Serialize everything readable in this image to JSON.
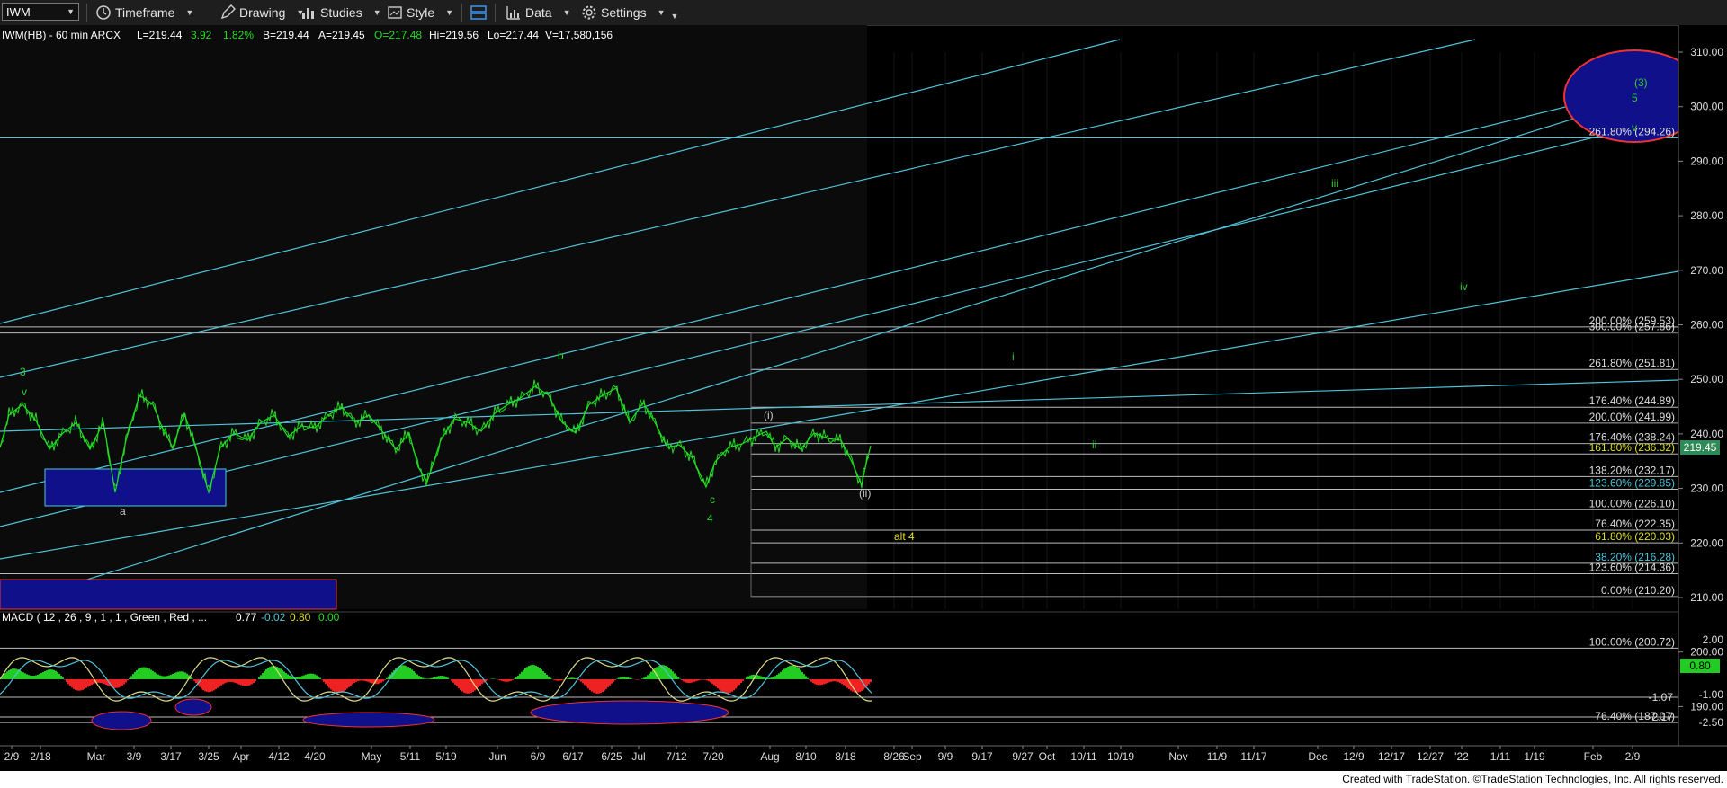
{
  "toolbar": {
    "symbol": "IWM",
    "timeframe": "Timeframe",
    "drawing": "Drawing",
    "studies": "Studies",
    "style": "Style",
    "data": "Data",
    "settings": "Settings"
  },
  "info": {
    "symbol": "IWM(HB) - 60 min  ARCX",
    "last_label": "L=219.44",
    "change": "3.92",
    "pct": "1.82%",
    "bid": "B=219.44",
    "ask": "A=219.45",
    "open": "O=217.48",
    "high": "Hi=219.56",
    "low": "Lo=217.44",
    "volume": "V=17,580,156"
  },
  "colors": {
    "price": "#22dd22",
    "trend": "#4fc3d8",
    "fib": "#cccccc",
    "wave_green": "#33cc33",
    "wave_yellow": "#dddd22",
    "rect_fill": "#10108a",
    "rect_border": "#ee3333",
    "macd_pos": "#22cc22",
    "macd_neg": "#ee2222",
    "last_tag": "#2e8b57"
  },
  "chart_data": [
    {
      "type": "line",
      "title": "IWM(HB) - 60 min ARCX",
      "y_axis_labels": [
        "310.00",
        "300.00",
        "290.00",
        "280.00",
        "270.00",
        "260.00",
        "250.00",
        "240.00",
        "230.00",
        "220.00",
        "210.00",
        "200.00",
        "190.00"
      ],
      "ylim": [
        183,
        314
      ],
      "x_axis_labels": [
        "2/9",
        "2/18",
        "Mar",
        "3/9",
        "3/17",
        "3/25",
        "Apr",
        "4/12",
        "4/20",
        "May",
        "5/11",
        "5/19",
        "Jun",
        "6/9",
        "6/17",
        "6/25",
        "Jul",
        "7/12",
        "7/20",
        "Aug",
        "8/10",
        "8/18",
        "8/26",
        "Sep",
        "9/9",
        "9/17",
        "9/27",
        "Oct",
        "10/11",
        "10/19",
        "Nov",
        "11/9",
        "11/17",
        "Dec",
        "12/9",
        "12/17",
        "12/27",
        "'22",
        "1/11",
        "1/19",
        "Feb",
        "2/9"
      ],
      "last_price": "219.45",
      "fib_labels": [
        {
          "text": "200.00% (259.53)",
          "value": 259.6
        },
        {
          "text": "300.00% (257.86)",
          "value": 258.5
        },
        {
          "text": "261.80% (251.81)",
          "value": 251.81
        },
        {
          "text": "176.40% (244.89)",
          "value": 244.89
        },
        {
          "text": "200.00% (241.99)",
          "value": 241.99
        },
        {
          "text": "176.40% (238.24)",
          "value": 238.24
        },
        {
          "text": "161.80% (236.32)",
          "value": 236.32
        },
        {
          "text": "138.20% (232.17)",
          "value": 232.17
        },
        {
          "text": "123.60% (229.85)",
          "value": 229.85
        },
        {
          "text": "100.00% (226.10)",
          "value": 226.1
        },
        {
          "text": "76.40% (222.35)",
          "value": 222.35
        },
        {
          "text": "61.80% (220.03)",
          "value": 220.03
        },
        {
          "text": "38.20% (216.28)",
          "value": 216.28
        },
        {
          "text": "123.60% (214.36)",
          "value": 214.36
        },
        {
          "text": "0.00% (210.20)",
          "value": 210.2
        },
        {
          "text": "100.00% (200.72)",
          "value": 200.72
        },
        {
          "text": "76.40% (187.07)",
          "value": 187.07
        },
        {
          "text": "261.80% (294.26)",
          "value": 294.26
        }
      ],
      "wave_labels": [
        "3",
        "v",
        "a",
        "b",
        "c",
        "4",
        "i",
        "ii",
        "iii",
        "iv",
        "v",
        "(3)",
        "5",
        "alt 4",
        "(i)",
        "(ii)"
      ]
    },
    {
      "type": "line",
      "title": "MACD ( 12 , 26 , 9 , 1 , 1 , Green , Red , ...",
      "values_text": [
        "0.77",
        "-0.02",
        "0.80",
        "0.00"
      ],
      "y_axis_labels": [
        "2.00",
        "-1.00",
        "-2.50"
      ],
      "level_labels": [
        "-1.07",
        "-2.17"
      ],
      "last_value": "0.80"
    }
  ],
  "footer": "Created with TradeStation. ©TradeStation Technologies, Inc. All rights reserved."
}
